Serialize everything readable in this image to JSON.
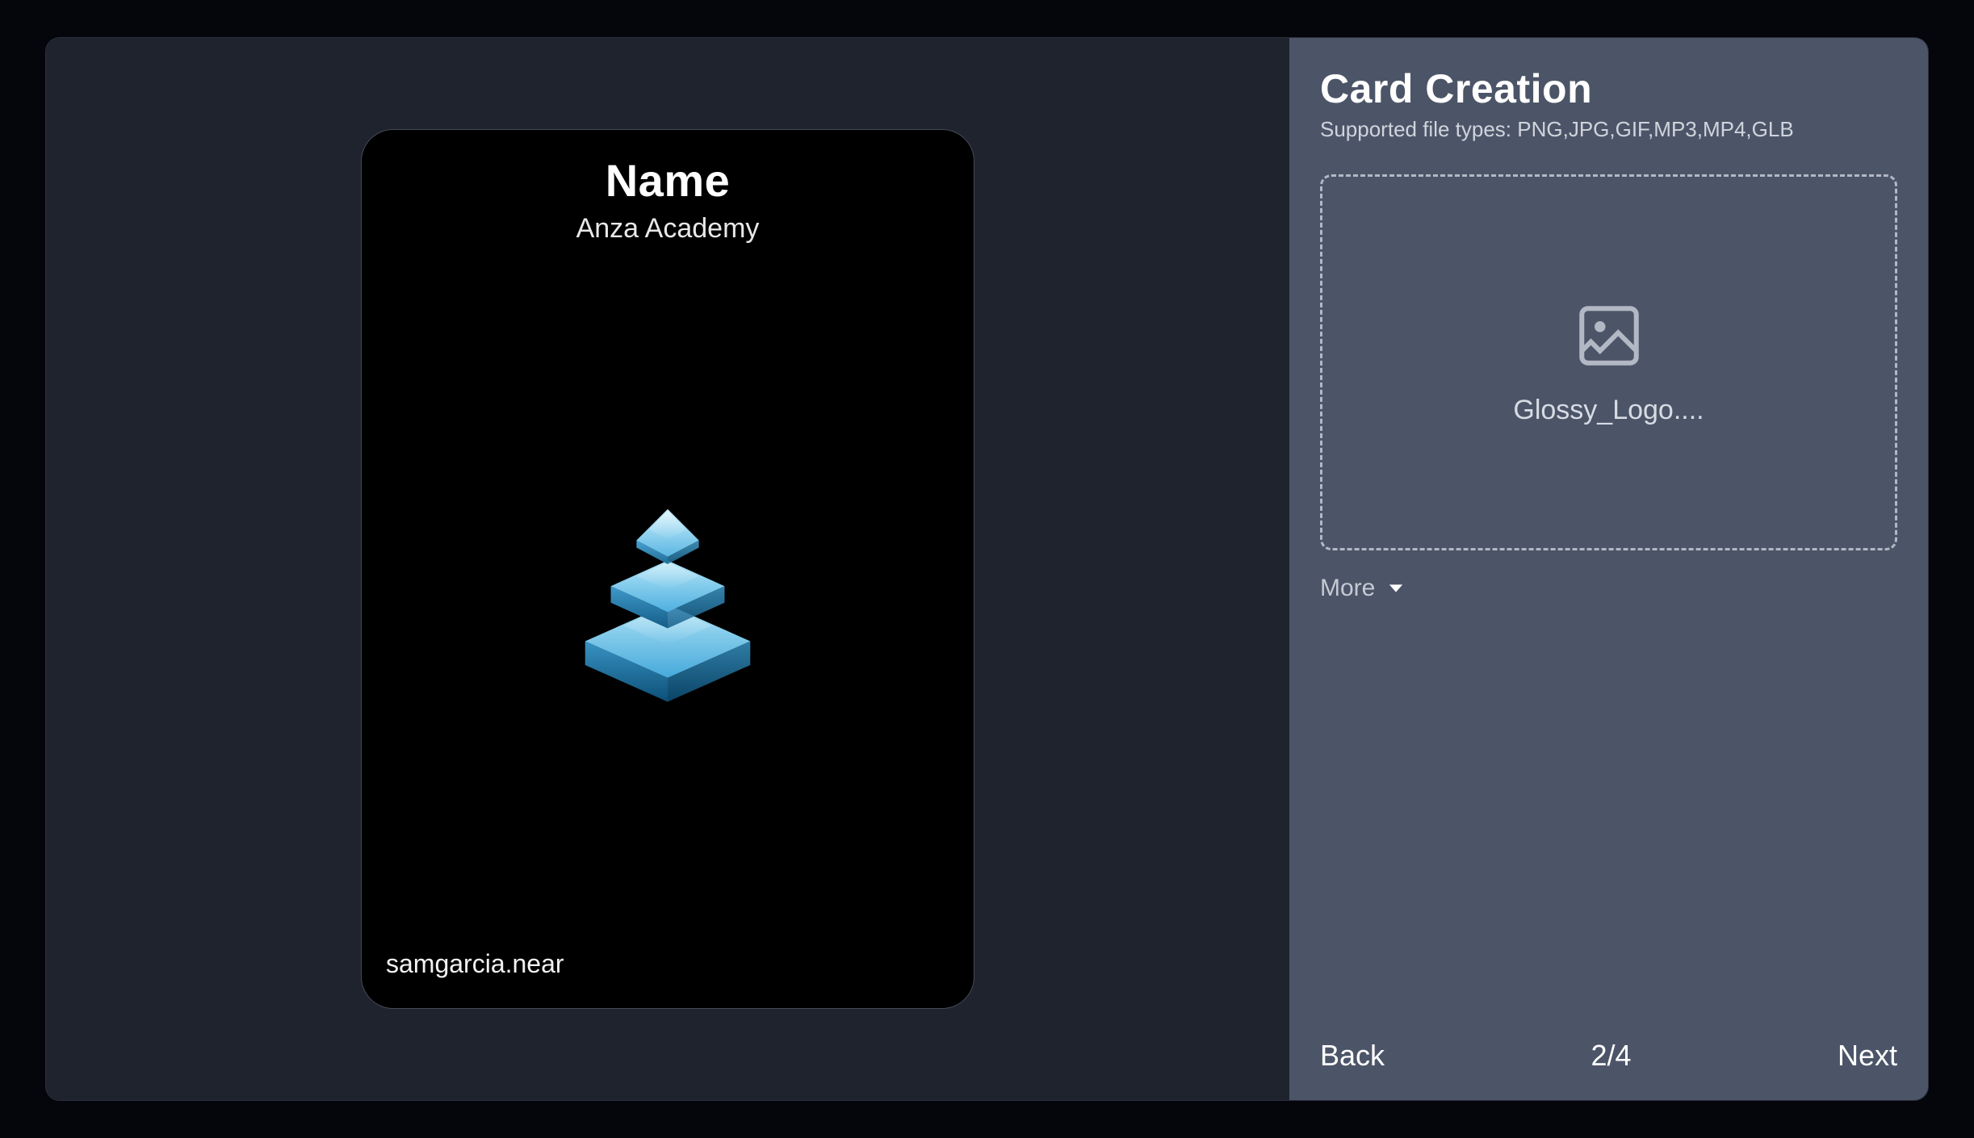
{
  "card": {
    "title": "Name",
    "subtitle": "Anza Academy",
    "footer": "samgarcia.near"
  },
  "side": {
    "title": "Card Creation",
    "subtitle": "Supported file types: PNG,JPG,GIF,MP3,MP4,GLB",
    "upload_filename": "Glossy_Logo....",
    "more_label": "More"
  },
  "nav": {
    "back": "Back",
    "step": "2/4",
    "next": "Next"
  }
}
